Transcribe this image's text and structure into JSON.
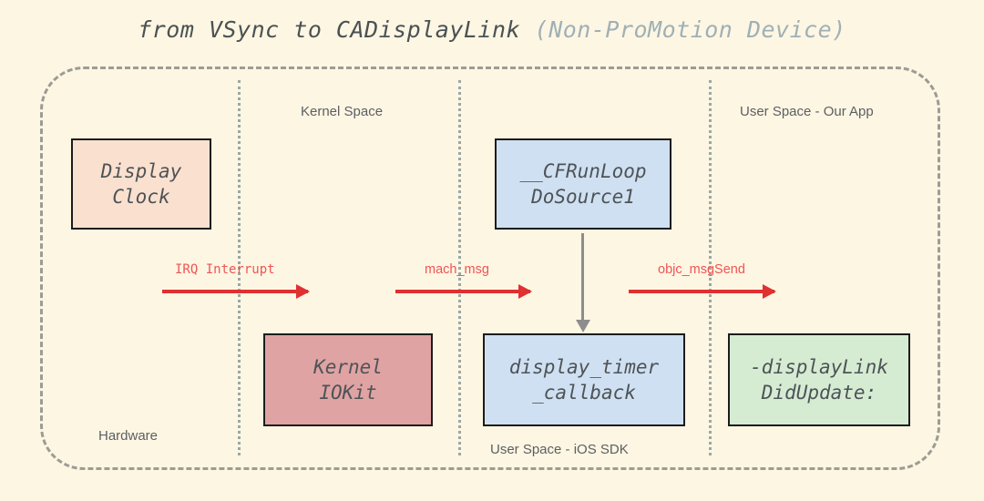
{
  "title": {
    "main": "from VSync to CADisplayLink ",
    "muted": "(Non-ProMotion Device)"
  },
  "zones": {
    "kernel_space": "Kernel Space",
    "user_space_our_app": "User Space - Our App",
    "hardware": "Hardware",
    "user_space_ios_sdk": "User Space - iOS SDK"
  },
  "nodes": {
    "display_clock": {
      "line1": "Display",
      "line2": "Clock",
      "color": "#fae0cf"
    },
    "kernel_iokit": {
      "line1": "Kernel",
      "line2": "IOKit",
      "color": "#dfa3a3"
    },
    "cfrunloop": {
      "line1": "__CFRunLoop",
      "line2": "DoSource1",
      "color": "#cfe0f2"
    },
    "display_timer": {
      "line1": "display_timer",
      "line2": "_callback",
      "color": "#cfe0f2"
    },
    "displaylink": {
      "line1": "-displayLink",
      "line2": "DidUpdate:",
      "color": "#d5ecd3"
    }
  },
  "arrows": {
    "irq": "IRQ Interrupt",
    "mach_msg": "mach_msg",
    "objc_msgsend": "objc_msgSend",
    "arrow_color": "#e03030",
    "vertical_color": "#8d8d8d"
  },
  "canvas": {
    "background": "#fdf6e3",
    "boundary_color": "#9c9c93",
    "separator_color": "#9aa8a5"
  }
}
